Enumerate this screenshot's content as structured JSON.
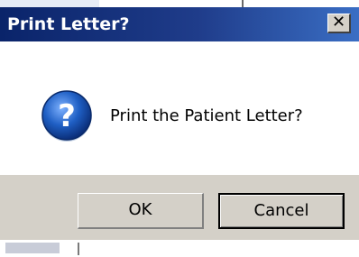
{
  "window": {
    "title": "Print Letter?",
    "close_glyph": "✕"
  },
  "dialog": {
    "icon": "question-icon",
    "message": "Print the Patient Letter?"
  },
  "buttons": {
    "ok_label": "OK",
    "cancel_label": "Cancel"
  },
  "colors": {
    "titlebar_start": "#0a246a",
    "titlebar_end": "#3a6ec4",
    "dialog_face": "#d4d0c8",
    "content_bg": "#ffffff",
    "icon_blue": "#1f5fc4"
  }
}
